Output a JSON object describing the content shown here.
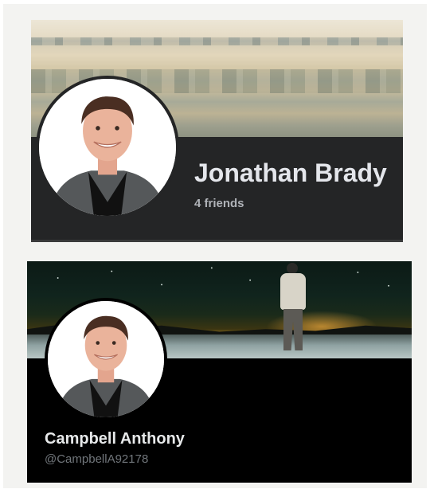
{
  "profiles": [
    {
      "platform_style": "facebook",
      "name": "Jonathan Brady",
      "subtext": "4 friends",
      "colors": {
        "background": "#242526",
        "name": "#e4e6eb",
        "subtext": "#b0b3b8"
      }
    },
    {
      "platform_style": "x",
      "name": "Campbell Anthony",
      "subtext": "@CampbellA92178",
      "colors": {
        "background": "#000000",
        "name": "#e7e9ea",
        "subtext": "#71767b"
      }
    }
  ],
  "icons": {
    "avatar": "profile-photo-man-smiling"
  }
}
